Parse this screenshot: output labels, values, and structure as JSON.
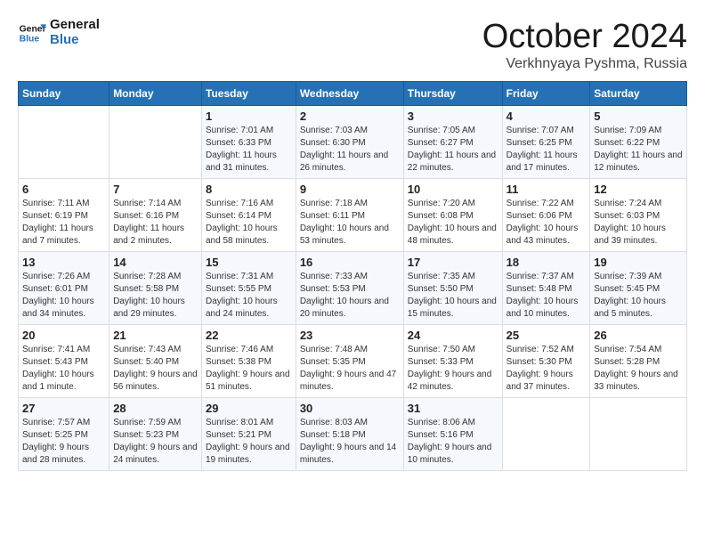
{
  "logo": {
    "line1": "General",
    "line2": "Blue"
  },
  "title": "October 2024",
  "location": "Verkhnyaya Pyshma, Russia",
  "headers": [
    "Sunday",
    "Monday",
    "Tuesday",
    "Wednesday",
    "Thursday",
    "Friday",
    "Saturday"
  ],
  "weeks": [
    [
      {
        "day": "",
        "info": ""
      },
      {
        "day": "",
        "info": ""
      },
      {
        "day": "1",
        "info": "Sunrise: 7:01 AM\nSunset: 6:33 PM\nDaylight: 11 hours and 31 minutes."
      },
      {
        "day": "2",
        "info": "Sunrise: 7:03 AM\nSunset: 6:30 PM\nDaylight: 11 hours and 26 minutes."
      },
      {
        "day": "3",
        "info": "Sunrise: 7:05 AM\nSunset: 6:27 PM\nDaylight: 11 hours and 22 minutes."
      },
      {
        "day": "4",
        "info": "Sunrise: 7:07 AM\nSunset: 6:25 PM\nDaylight: 11 hours and 17 minutes."
      },
      {
        "day": "5",
        "info": "Sunrise: 7:09 AM\nSunset: 6:22 PM\nDaylight: 11 hours and 12 minutes."
      }
    ],
    [
      {
        "day": "6",
        "info": "Sunrise: 7:11 AM\nSunset: 6:19 PM\nDaylight: 11 hours and 7 minutes."
      },
      {
        "day": "7",
        "info": "Sunrise: 7:14 AM\nSunset: 6:16 PM\nDaylight: 11 hours and 2 minutes."
      },
      {
        "day": "8",
        "info": "Sunrise: 7:16 AM\nSunset: 6:14 PM\nDaylight: 10 hours and 58 minutes."
      },
      {
        "day": "9",
        "info": "Sunrise: 7:18 AM\nSunset: 6:11 PM\nDaylight: 10 hours and 53 minutes."
      },
      {
        "day": "10",
        "info": "Sunrise: 7:20 AM\nSunset: 6:08 PM\nDaylight: 10 hours and 48 minutes."
      },
      {
        "day": "11",
        "info": "Sunrise: 7:22 AM\nSunset: 6:06 PM\nDaylight: 10 hours and 43 minutes."
      },
      {
        "day": "12",
        "info": "Sunrise: 7:24 AM\nSunset: 6:03 PM\nDaylight: 10 hours and 39 minutes."
      }
    ],
    [
      {
        "day": "13",
        "info": "Sunrise: 7:26 AM\nSunset: 6:01 PM\nDaylight: 10 hours and 34 minutes."
      },
      {
        "day": "14",
        "info": "Sunrise: 7:28 AM\nSunset: 5:58 PM\nDaylight: 10 hours and 29 minutes."
      },
      {
        "day": "15",
        "info": "Sunrise: 7:31 AM\nSunset: 5:55 PM\nDaylight: 10 hours and 24 minutes."
      },
      {
        "day": "16",
        "info": "Sunrise: 7:33 AM\nSunset: 5:53 PM\nDaylight: 10 hours and 20 minutes."
      },
      {
        "day": "17",
        "info": "Sunrise: 7:35 AM\nSunset: 5:50 PM\nDaylight: 10 hours and 15 minutes."
      },
      {
        "day": "18",
        "info": "Sunrise: 7:37 AM\nSunset: 5:48 PM\nDaylight: 10 hours and 10 minutes."
      },
      {
        "day": "19",
        "info": "Sunrise: 7:39 AM\nSunset: 5:45 PM\nDaylight: 10 hours and 5 minutes."
      }
    ],
    [
      {
        "day": "20",
        "info": "Sunrise: 7:41 AM\nSunset: 5:43 PM\nDaylight: 10 hours and 1 minute."
      },
      {
        "day": "21",
        "info": "Sunrise: 7:43 AM\nSunset: 5:40 PM\nDaylight: 9 hours and 56 minutes."
      },
      {
        "day": "22",
        "info": "Sunrise: 7:46 AM\nSunset: 5:38 PM\nDaylight: 9 hours and 51 minutes."
      },
      {
        "day": "23",
        "info": "Sunrise: 7:48 AM\nSunset: 5:35 PM\nDaylight: 9 hours and 47 minutes."
      },
      {
        "day": "24",
        "info": "Sunrise: 7:50 AM\nSunset: 5:33 PM\nDaylight: 9 hours and 42 minutes."
      },
      {
        "day": "25",
        "info": "Sunrise: 7:52 AM\nSunset: 5:30 PM\nDaylight: 9 hours and 37 minutes."
      },
      {
        "day": "26",
        "info": "Sunrise: 7:54 AM\nSunset: 5:28 PM\nDaylight: 9 hours and 33 minutes."
      }
    ],
    [
      {
        "day": "27",
        "info": "Sunrise: 7:57 AM\nSunset: 5:25 PM\nDaylight: 9 hours and 28 minutes."
      },
      {
        "day": "28",
        "info": "Sunrise: 7:59 AM\nSunset: 5:23 PM\nDaylight: 9 hours and 24 minutes."
      },
      {
        "day": "29",
        "info": "Sunrise: 8:01 AM\nSunset: 5:21 PM\nDaylight: 9 hours and 19 minutes."
      },
      {
        "day": "30",
        "info": "Sunrise: 8:03 AM\nSunset: 5:18 PM\nDaylight: 9 hours and 14 minutes."
      },
      {
        "day": "31",
        "info": "Sunrise: 8:06 AM\nSunset: 5:16 PM\nDaylight: 9 hours and 10 minutes."
      },
      {
        "day": "",
        "info": ""
      },
      {
        "day": "",
        "info": ""
      }
    ]
  ]
}
